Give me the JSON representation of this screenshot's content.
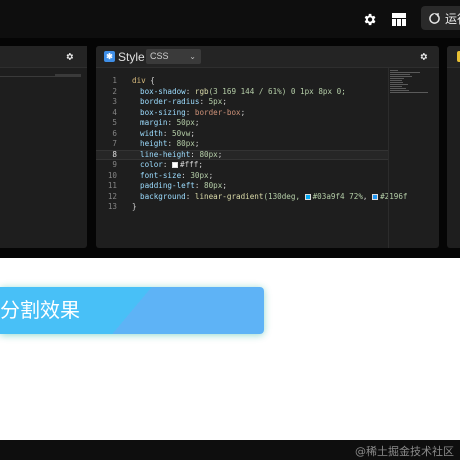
{
  "toolbar": {
    "run_label": "运行",
    "icons": [
      "gear-icon",
      "layout-icon",
      "run-icon"
    ]
  },
  "style_panel": {
    "title": "Style",
    "language": "CSS",
    "code_lines": [
      {
        "no": "1"
      },
      {
        "no": "2"
      },
      {
        "no": "3"
      },
      {
        "no": "4"
      },
      {
        "no": "5"
      },
      {
        "no": "6"
      },
      {
        "no": "7"
      },
      {
        "no": "8"
      },
      {
        "no": "9"
      },
      {
        "no": "10"
      },
      {
        "no": "11"
      },
      {
        "no": "12"
      },
      {
        "no": "13"
      }
    ],
    "code": {
      "l1_selector": "div",
      "l1_brace": " {",
      "l2_prop": "box-shadow",
      "l2_fn": "rgb",
      "l2_args": "(3 169 144 / 61%)",
      "l2_rest": " 0 1px 8px 0;",
      "l3_prop": "border-radius",
      "l3_val": "5px",
      "l4_prop": "box-sizing",
      "l4_val": "border-box",
      "l5_prop": "margin",
      "l5_val": "50px",
      "l6_prop": "width",
      "l6_val": "50vw",
      "l7_prop": "height",
      "l7_val": "80px",
      "l8_prop": "line-height",
      "l8_val": "80px",
      "l9_prop": "color",
      "l9_val": "#fff",
      "l10_prop": "font-size",
      "l10_val": "30px",
      "l11_prop": "padding-left",
      "l11_val": "80px",
      "l12_prop": "background",
      "l12_fn": "linear-gradient",
      "l12_a": "(130deg, ",
      "l12_c1": "#03a9f4 72%",
      "l12_sep": ", ",
      "l12_c2": "#2196f",
      "l13_brace": "}"
    },
    "swatch_colors": {
      "white": "#ffffff",
      "c1": "#03a9f4",
      "c2": "#2196f3"
    }
  },
  "preview": {
    "text": "分割效果",
    "gradient_start": "#03a9f4",
    "gradient_end": "#2196f3"
  },
  "footer": {
    "watermark": "@稀土掘金技术社区"
  }
}
